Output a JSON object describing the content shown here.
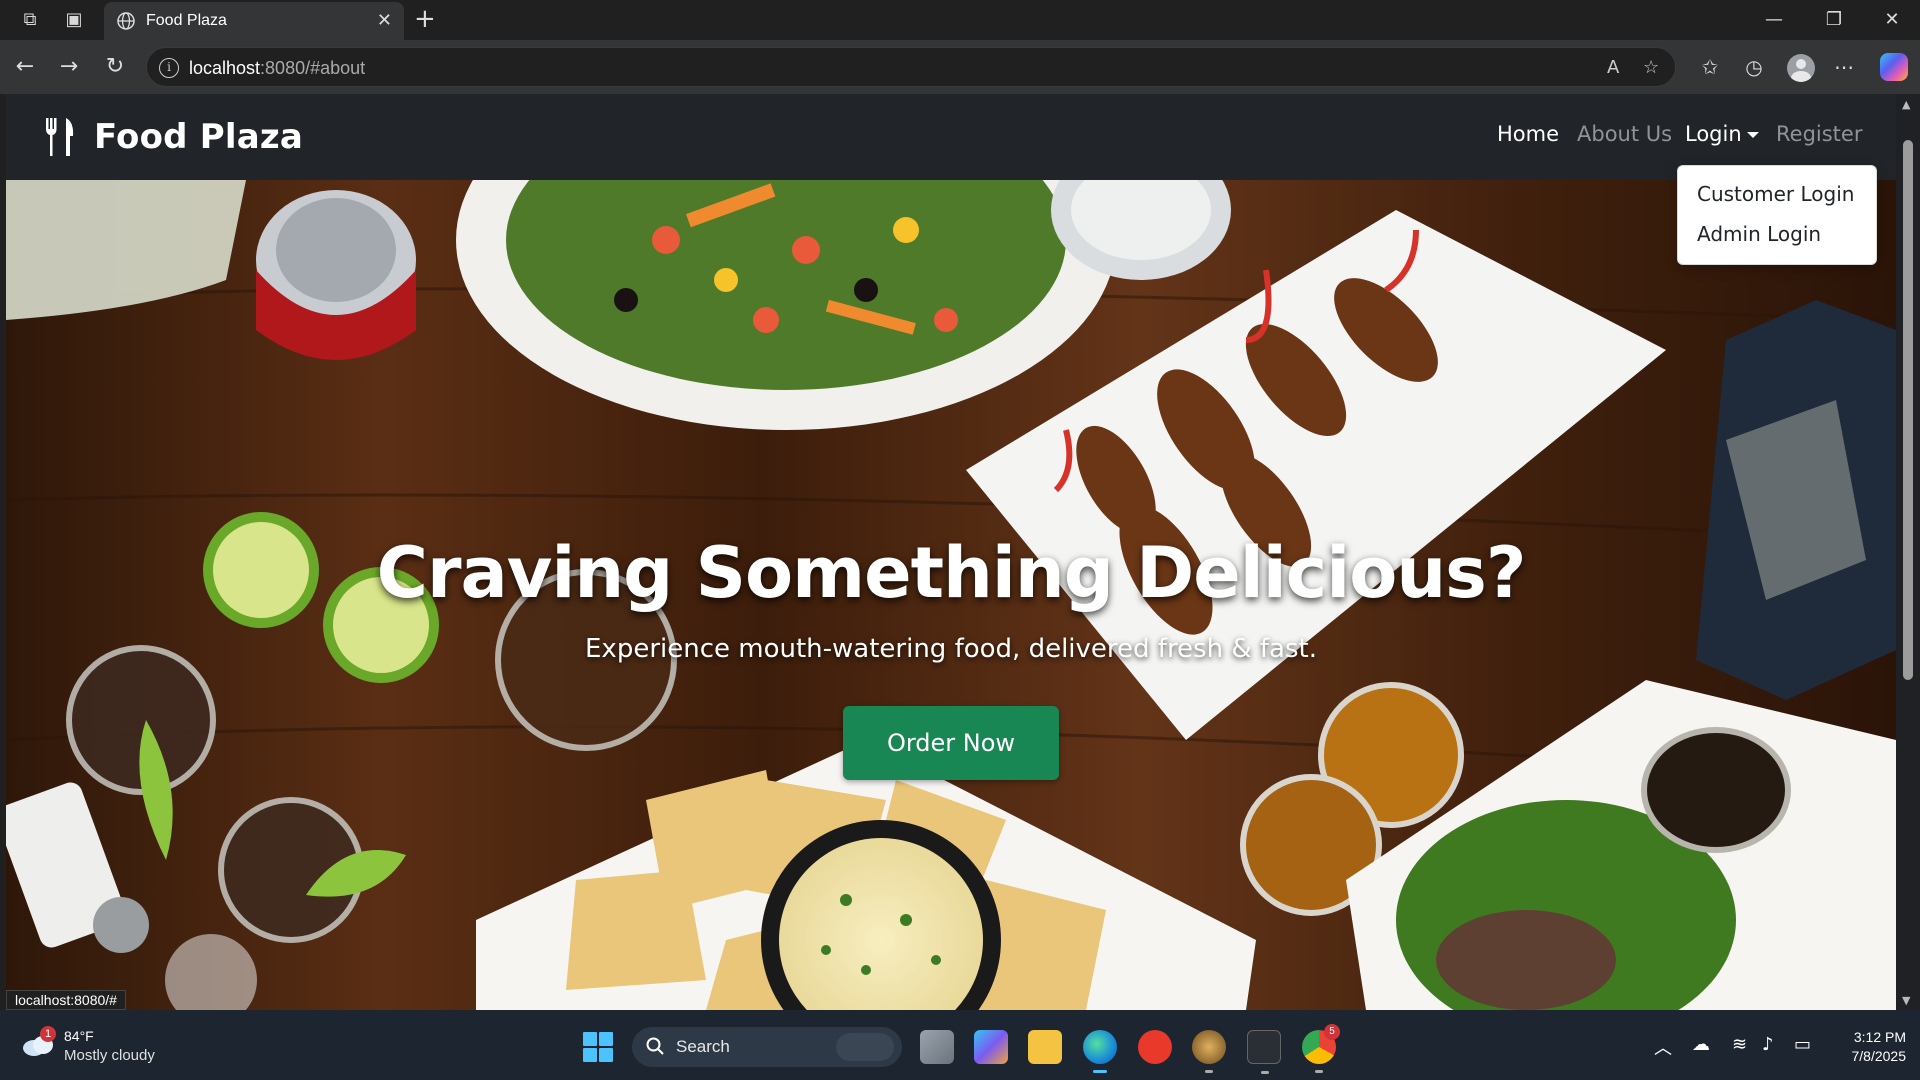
{
  "browser": {
    "tab_title": "Food Plaza",
    "url_host": "localhost",
    "url_rest": ":8080/#about",
    "status_link": "localhost:8080/#"
  },
  "site": {
    "brand": "Food Plaza",
    "nav": {
      "home": "Home",
      "about": "About Us",
      "login": "Login",
      "register": "Register"
    },
    "login_menu": {
      "customer": "Customer Login",
      "admin": "Admin Login"
    },
    "hero": {
      "title": "Craving Something Delicious?",
      "subtitle": "Experience mouth-watering food, delivered fresh & fast.",
      "cta": "Order Now"
    },
    "colors": {
      "navbar": "#212529",
      "cta": "#198754"
    }
  },
  "taskbar": {
    "weather_temp": "84°F",
    "weather_cond": "Mostly cloudy",
    "weather_badge": "1",
    "search_label": "Search",
    "time": "3:12 PM",
    "date": "7/8/2025",
    "chrome_badge": "5"
  }
}
